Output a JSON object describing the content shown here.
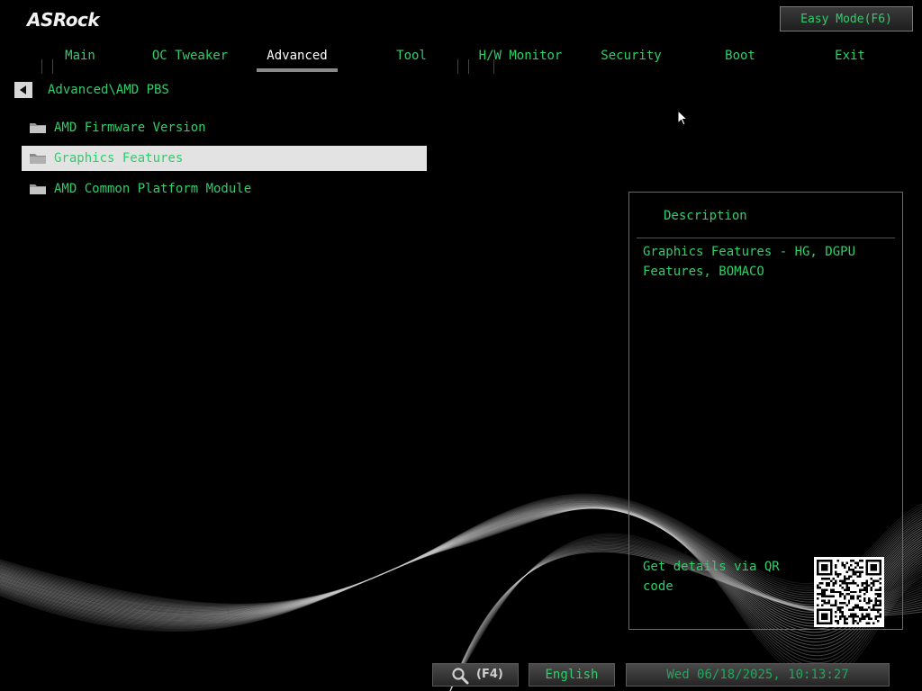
{
  "brand": {
    "logo_text": "ASRock"
  },
  "header": {
    "easy_mode_label": "Easy Mode(F6)"
  },
  "tabs": [
    {
      "label": "Main"
    },
    {
      "label": "OC Tweaker"
    },
    {
      "label": "Advanced",
      "active": true
    },
    {
      "label": "Tool"
    },
    {
      "label": "H/W Monitor"
    },
    {
      "label": "Security"
    },
    {
      "label": "Boot"
    },
    {
      "label": "Exit"
    }
  ],
  "breadcrumb": {
    "path": "Advanced\\AMD PBS"
  },
  "menu": {
    "items": [
      {
        "label": "AMD Firmware Version",
        "icon": "folder-icon"
      },
      {
        "label": "Graphics Features",
        "icon": "folder-icon",
        "selected": true
      },
      {
        "label": "AMD Common Platform Module",
        "icon": "folder-icon"
      }
    ]
  },
  "description": {
    "title": "Description",
    "text": "Graphics Features - HG, DGPU\nFeatures, BOMACO",
    "qr_label": "Get details via QR\ncode"
  },
  "footer": {
    "search_shortcut": "(F4)",
    "language": "English",
    "datetime": "Wed 06/18/2025, 10:13:27"
  },
  "colors": {
    "accent_green": "#2ecf6a",
    "background": "#000000",
    "active_tab_text": "#ffffff",
    "selected_row_bg": "#e3e3e3"
  }
}
